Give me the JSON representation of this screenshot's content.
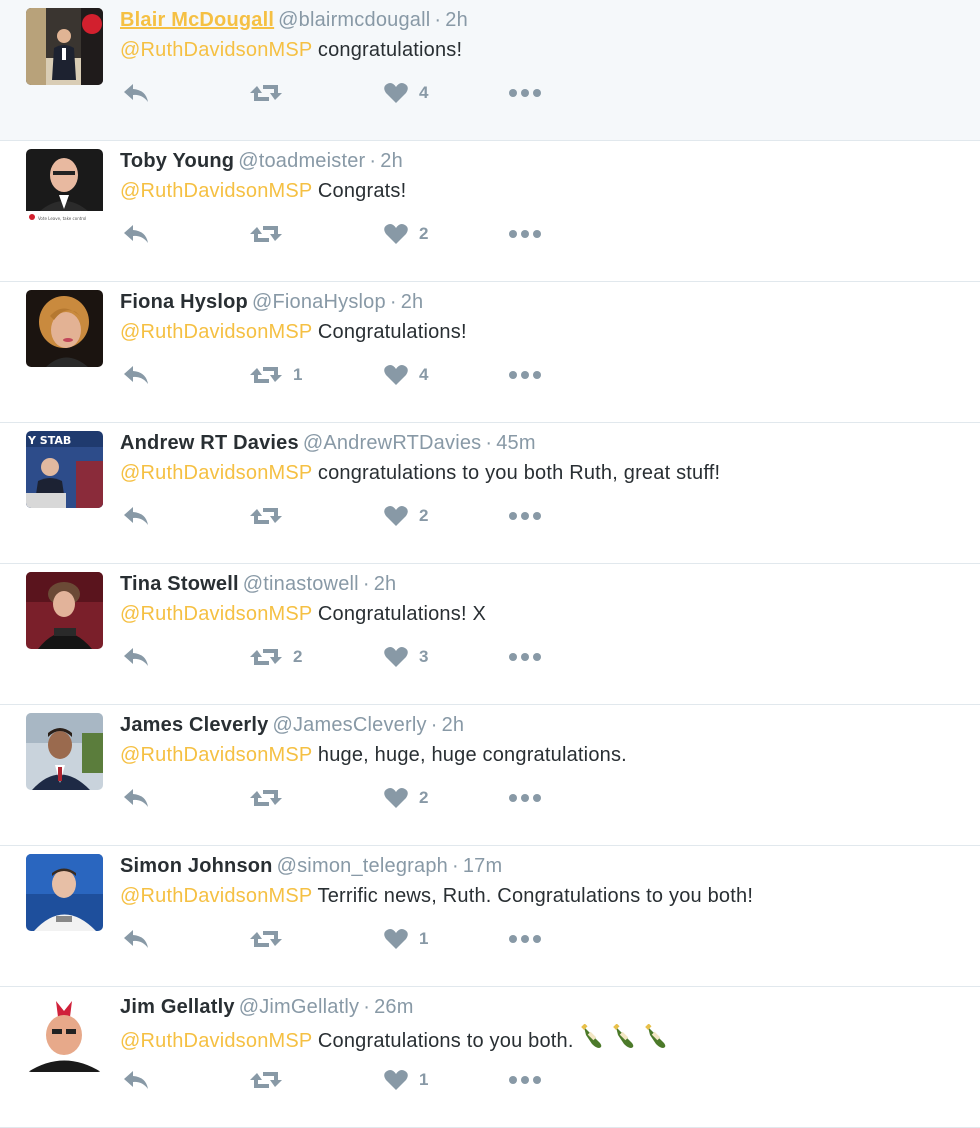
{
  "tweets": [
    {
      "name": "Blair McDougall",
      "handle": "@blairmcdougall",
      "time": "2h",
      "mention": "@RuthDavidsonMSP",
      "text": " congratulations!",
      "retweets": "",
      "likes": "4",
      "highlight": true,
      "avatar": "avatar-blair"
    },
    {
      "name": "Toby Young",
      "handle": "@toadmeister",
      "time": "2h",
      "mention": "@RuthDavidsonMSP",
      "text": " Congrats!",
      "retweets": "",
      "likes": "2",
      "highlight": false,
      "avatar": "avatar-toby"
    },
    {
      "name": "Fiona Hyslop",
      "handle": "@FionaHyslop",
      "time": "2h",
      "mention": "@RuthDavidsonMSP",
      "text": " Congratulations!",
      "retweets": "1",
      "likes": "4",
      "highlight": false,
      "avatar": "avatar-fiona"
    },
    {
      "name": "Andrew RT Davies",
      "handle": "@AndrewRTDavies",
      "time": "45m",
      "mention": "@RuthDavidsonMSP",
      "text": " congratulations to you both Ruth, great stuff!",
      "retweets": "",
      "likes": "2",
      "highlight": false,
      "avatar": "avatar-andrew"
    },
    {
      "name": "Tina Stowell",
      "handle": "@tinastowell",
      "time": "2h",
      "mention": "@RuthDavidsonMSP",
      "text": " Congratulations! X",
      "retweets": "2",
      "likes": "3",
      "highlight": false,
      "avatar": "avatar-tina"
    },
    {
      "name": "James Cleverly",
      "handle": "@JamesCleverly",
      "time": "2h",
      "mention": "@RuthDavidsonMSP",
      "text": " huge, huge, huge congratulations.",
      "retweets": "",
      "likes": "2",
      "highlight": false,
      "avatar": "avatar-james"
    },
    {
      "name": "Simon Johnson",
      "handle": "@simon_telegraph",
      "time": "17m",
      "mention": "@RuthDavidsonMSP",
      "text": " Terrific news, Ruth. Congratulations to you both!",
      "retweets": "",
      "likes": "1",
      "highlight": false,
      "avatar": "avatar-simon"
    },
    {
      "name": "Jim Gellatly",
      "handle": "@JimGellatly",
      "time": "26m",
      "mention": "@RuthDavidsonMSP",
      "text": " Congratulations to you both.",
      "retweets": "",
      "likes": "1",
      "highlight": false,
      "avatar": "avatar-jim",
      "emoji": [
        "champagne-icon",
        "champagne-icon",
        "champagne-icon"
      ]
    }
  ],
  "avatar_text": {
    "toby_caption": "Vote Leave, take control",
    "andrew_banner": "Y STAB"
  },
  "colors": {
    "mention": "#f5c043",
    "name": "#292f33",
    "meta": "#8899a6",
    "icon": "#8899a6",
    "highlight_bg": "#f5f8fa",
    "divider": "#e1e8ed"
  }
}
